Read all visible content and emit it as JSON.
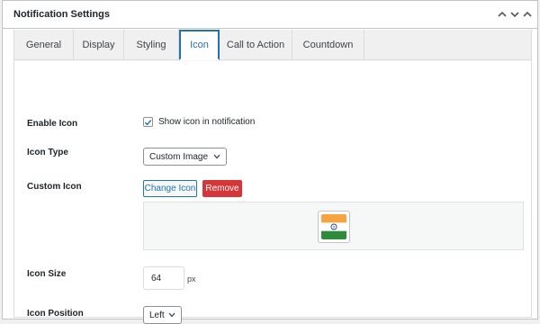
{
  "panel": {
    "title": "Notification Settings"
  },
  "tabs": [
    {
      "label": "General"
    },
    {
      "label": "Display"
    },
    {
      "label": "Styling"
    },
    {
      "label": "Icon"
    },
    {
      "label": "Call to Action"
    },
    {
      "label": "Countdown"
    }
  ],
  "active_tab": "Icon",
  "fields": {
    "enable_icon": {
      "label": "Enable Icon",
      "checkbox_text": "Show icon in notification",
      "checked": true
    },
    "icon_type": {
      "label": "Icon Type",
      "value": "Custom Image"
    },
    "custom_icon": {
      "label": "Custom Icon",
      "change_label": "Change Icon",
      "remove_label": "Remove",
      "preview_icon": "india-flag-icon"
    },
    "icon_size": {
      "label": "Icon Size",
      "value": "64",
      "unit": "px"
    },
    "icon_position": {
      "label": "Icon Position",
      "value": "Left"
    }
  },
  "colors": {
    "accent": "#2271b1",
    "danger": "#d63638",
    "flag_saffron": "#f7a440",
    "flag_green": "#2e8b3a",
    "flag_chakra": "#1c3f94"
  }
}
